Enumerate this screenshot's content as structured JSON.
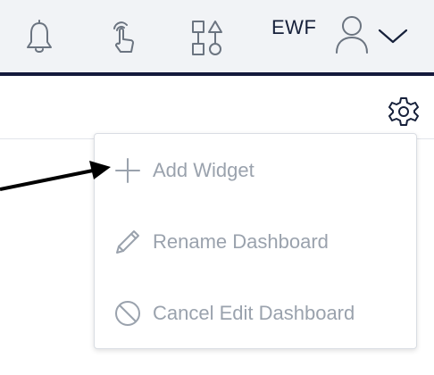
{
  "header": {
    "icons": [
      {
        "name": "bell-icon"
      },
      {
        "name": "touch-icon"
      },
      {
        "name": "shapes-icon"
      }
    ],
    "user_initials": "EWF",
    "user_icon": "user-icon",
    "menu_toggle_icon": "chevron-down-icon"
  },
  "toolbar": {
    "settings_icon": "gear-icon"
  },
  "dashboard_menu": {
    "items": [
      {
        "label": "Add Widget",
        "icon": "plus-icon"
      },
      {
        "label": "Rename Dashboard",
        "icon": "pencil-icon"
      },
      {
        "label": "Cancel Edit Dashboard",
        "icon": "cancel-icon"
      }
    ]
  },
  "colors": {
    "header_bg": "#f1f3f6",
    "header_border": "#141a3c",
    "icon": "#6b7480",
    "menu_text": "#9aa2ad"
  }
}
